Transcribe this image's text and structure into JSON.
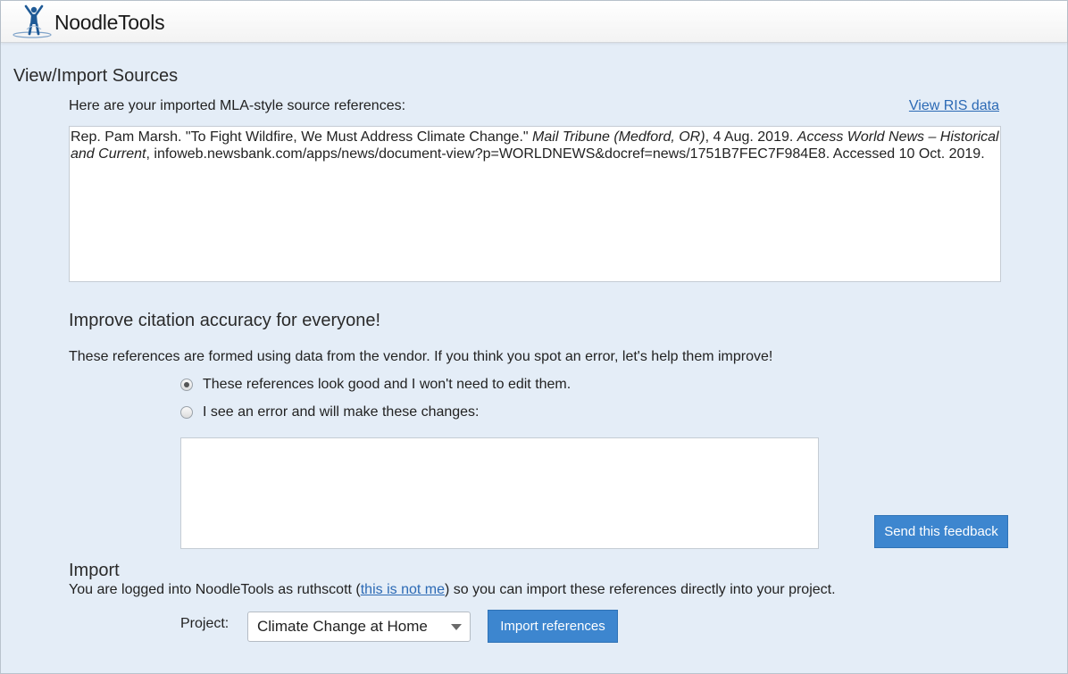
{
  "header": {
    "logo_text": "NoodleTools"
  },
  "page": {
    "title": "View/Import Sources",
    "intro": "Here are your imported MLA-style source references:",
    "ris_link": "View RIS data"
  },
  "citation": {
    "part1": "Rep. Pam Marsh. \"To Fight Wildfire, We Must Address Climate Change.\" ",
    "italic1": "Mail Tribune (Medford, OR)",
    "part2": ", 4 Aug. 2019. ",
    "italic2": "Access World News – Historical and Current",
    "part3": ", infoweb.newsbank.com/apps/news/document-view?p=WORLDNEWS&docref=news/1751B7FEC7F984E8. Accessed 10 Oct. 2019."
  },
  "improve": {
    "title": "Improve citation accuracy for everyone!",
    "text": "These references are formed using data from the vendor. If you think you spot an error, let's help them improve!",
    "option_good": "These references look good and I won't need to edit them.",
    "option_error": "I see an error and will make these changes:",
    "send_button": "Send this feedback"
  },
  "import": {
    "title": "Import",
    "text_before": "You are logged into NoodleTools as ruthscott (",
    "not_me_link": "this is not me",
    "text_after": ") so you can import these references directly into your project.",
    "project_label": "Project:",
    "project_selected": "Climate Change at Home",
    "import_button": "Import references"
  },
  "colors": {
    "accent": "#3d86cf",
    "link": "#2c6ab5",
    "background": "#e4edf7"
  }
}
